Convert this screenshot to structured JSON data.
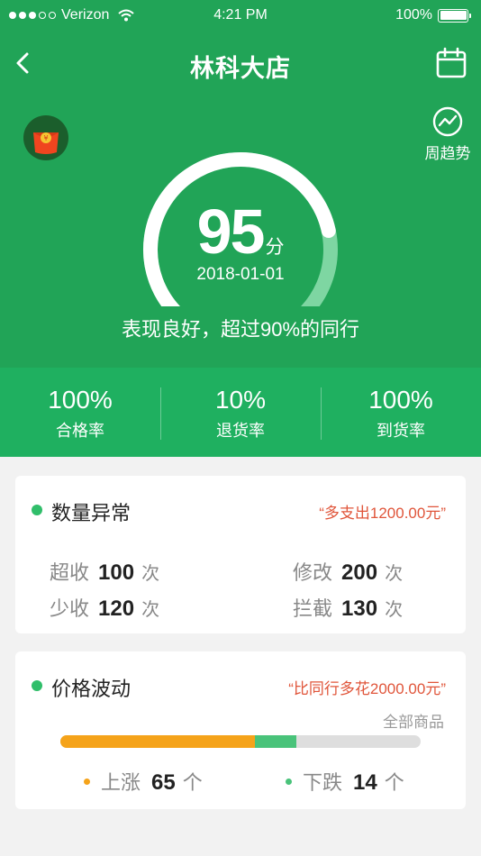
{
  "status_bar": {
    "carrier": "Verizon",
    "time": "4:21 PM",
    "battery": "100%",
    "signal_bars": 3,
    "battery_level": 1.0
  },
  "nav": {
    "title": "林科大店",
    "back_icon": "chevron-left-icon",
    "calendar_icon": "calendar-icon"
  },
  "trend": {
    "label": "周趋势",
    "icon": "trend-line-icon"
  },
  "avatar": {
    "icon": "red-envelope-icon"
  },
  "score": {
    "value": "95",
    "unit": "分",
    "date": "2018-01-01",
    "summary": "表现良好，超过90%的同行",
    "max": 100,
    "value_num": 95
  },
  "stats": [
    {
      "value": "100%",
      "label": "合格率"
    },
    {
      "value": "10%",
      "label": "退货率"
    },
    {
      "value": "100%",
      "label": "到货率"
    }
  ],
  "quantity": {
    "title": "数量异常",
    "note": "“多支出1200.00元”",
    "items": [
      {
        "label": "超收",
        "value": "100",
        "unit": "次"
      },
      {
        "label": "修改",
        "value": "200",
        "unit": "次"
      },
      {
        "label": "少收",
        "value": "120",
        "unit": "次"
      },
      {
        "label": "拦截",
        "value": "130",
        "unit": "次"
      }
    ]
  },
  "price": {
    "title": "价格波动",
    "note": "“比同行多花2000.00元”",
    "filter": "全部商品",
    "up": {
      "label": "上涨",
      "value": "65",
      "unit": "个"
    },
    "down": {
      "label": "下跌",
      "value": "14",
      "unit": "个"
    }
  },
  "colors": {
    "brand": "#21a457",
    "stats_bg": "#1fb060",
    "accent_red": "#e0553a",
    "up": "#f5a31a",
    "down": "#49c37a"
  }
}
